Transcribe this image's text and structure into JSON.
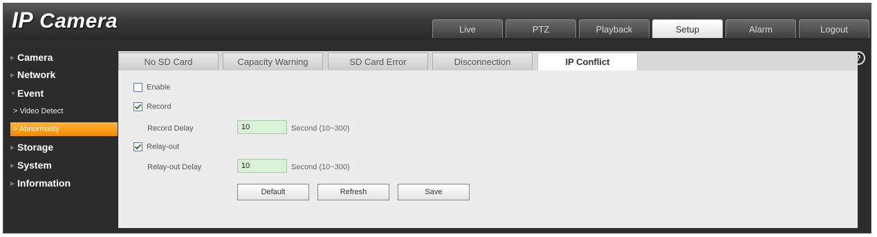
{
  "app": {
    "title_prefix": "IP",
    "title_suffix": " Camera"
  },
  "topnav": [
    {
      "label": "Live",
      "active": false
    },
    {
      "label": "PTZ",
      "active": false
    },
    {
      "label": "Playback",
      "active": false
    },
    {
      "label": "Setup",
      "active": true
    },
    {
      "label": "Alarm",
      "active": false
    },
    {
      "label": "Logout",
      "active": false
    }
  ],
  "sidebar": {
    "items": [
      {
        "label": "Camera"
      },
      {
        "label": "Network"
      },
      {
        "label": "Event",
        "expanded": true
      },
      {
        "label": "> Video Detect"
      },
      {
        "label": "> Abnormality",
        "active": true
      },
      {
        "label": "Storage"
      },
      {
        "label": "System"
      },
      {
        "label": "Information"
      }
    ]
  },
  "tabs": [
    {
      "label": "No SD Card"
    },
    {
      "label": "Capacity Warning"
    },
    {
      "label": "SD Card Error"
    },
    {
      "label": "Disconnection"
    },
    {
      "label": "IP Conflict",
      "active": true
    }
  ],
  "help_icon": "?",
  "form": {
    "enable": {
      "label": "Enable",
      "checked": false
    },
    "record": {
      "label": "Record",
      "checked": true
    },
    "record_delay": {
      "label": "Record Delay",
      "value": "10",
      "hint": "Second (10~300)"
    },
    "relay_out": {
      "label": "Relay-out",
      "checked": true
    },
    "relay_out_delay": {
      "label": "Relay-out Delay",
      "value": "10",
      "hint": "Second (10~300)"
    }
  },
  "buttons": {
    "default": "Default",
    "refresh": "Refresh",
    "save": "Save"
  },
  "colors": {
    "accent": "#f08a00",
    "background": "#2c2c2c",
    "panel": "#ececec"
  }
}
